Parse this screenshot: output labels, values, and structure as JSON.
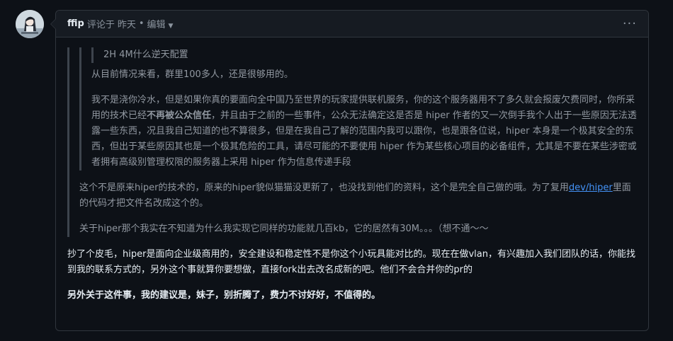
{
  "comment": {
    "author": "ffip",
    "action_text": "评论于",
    "time_text": "昨天",
    "separator": "•",
    "edit_label": "编辑",
    "more_label": "···"
  },
  "quote": {
    "level3_text": "2H 4M什么逆天配置",
    "level2_text": "从目前情况来看，群里100多人，还是很够用的。",
    "level2_para_pre": "我不是浇你冷水，但是如果你真的要面向全中国乃至世界的玩家提供联机服务，你的这个服务器用不了多久就会报废欠费同时，你所采用的技术已经",
    "level2_para_bold": "不再被公众信任",
    "level2_para_post": "，并且由于之前的一些事件，公众无法确定这是否是 hiper 作者的又一次倒手我个人出于一些原因无法透露一些东西，况且我自己知道的也不算很多，但是在我自己了解的范围内我可以跟你，也是跟各位说，hiper 本身是一个极其安全的东西，但出于某些原因其也是一个极其危险的工具，请尽可能的不要使用 hiper 作为某些核心项目的必备组件，尤其是不要在某些涉密或者拥有高级别管理权限的服务器上采用 hiper 作为信息传递手段",
    "level1_para1_pre": "这个不是原来hiper的技术的，原来的hiper貌似猫猫没更新了，也没找到他们的资料，这个是完全自己做的哦。为了复用",
    "level1_link": "dev/hiper",
    "level1_para1_post": "里面的代码才把文件名改成这个的。",
    "level1_para2": "关于hiper那个我实在不知道为什么我实现它同样的功能就几百kb，它的居然有30M。。。（想不通～～"
  },
  "reply": {
    "para1": "抄了个皮毛，hiper是面向企业级商用的，安全建设和稳定性不是你这个小玩具能对比的。现在在做vlan，有兴趣加入我们团队的话，你能找到我的联系方式的，另外这个事就算你要想做，直接fork出去改名成新的吧。他们不会合并你的pr的",
    "para2": "另外关于这件事，我的建议是，妹子，别折腾了，费力不讨好好，不值得的。"
  }
}
